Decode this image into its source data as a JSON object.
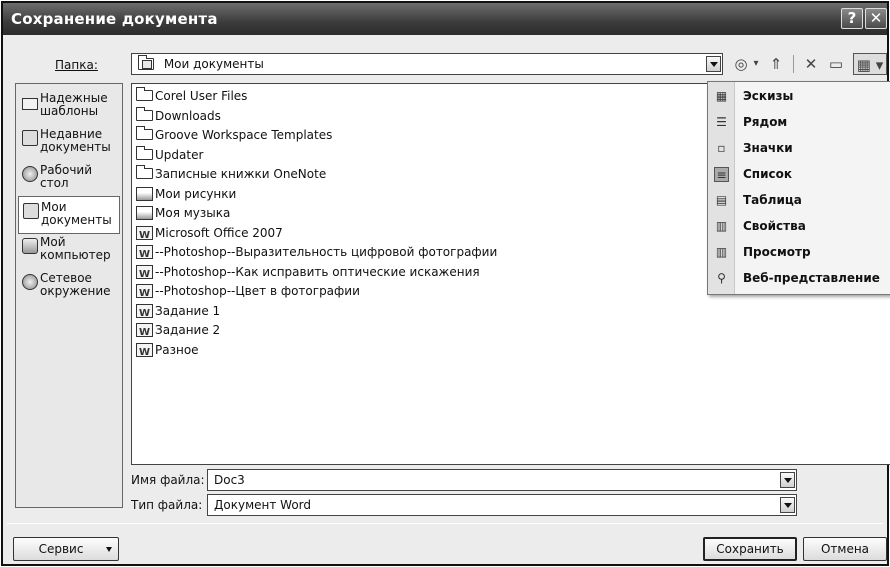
{
  "window": {
    "title": "Сохранение документа",
    "help_label": "?",
    "close_label": "✕"
  },
  "location": {
    "label": "Папка:",
    "value": "Мои документы"
  },
  "toolbar": {
    "back_icon": "◎",
    "back_dd": "▾",
    "up_icon": "⇑",
    "delete_icon": "✕",
    "newfolder_icon": "▭",
    "views_icon": "▦ ▾"
  },
  "places": [
    {
      "label": "Надежные\nшаблоны",
      "icon": "folder-icon"
    },
    {
      "label": "Недавние\nдокументы",
      "icon": "recent-documents-icon"
    },
    {
      "label": "Рабочий\nстол",
      "icon": "desktop-icon"
    },
    {
      "label": "Мои\nдокументы",
      "icon": "my-documents-icon",
      "selected": true
    },
    {
      "label": "Мой\nкомпьютер",
      "icon": "my-computer-icon"
    },
    {
      "label": "Сетевое\nокружение",
      "icon": "network-icon"
    }
  ],
  "files": [
    {
      "name": "Corel User Files",
      "type": "folder"
    },
    {
      "name": "Downloads",
      "type": "folder"
    },
    {
      "name": "Groove Workspace Templates",
      "type": "folder"
    },
    {
      "name": "Updater",
      "type": "folder"
    },
    {
      "name": "Записные книжки OneNote",
      "type": "folder"
    },
    {
      "name": "Мои рисунки",
      "type": "pictures"
    },
    {
      "name": "Моя музыка",
      "type": "music"
    },
    {
      "name": "Microsoft Office 2007",
      "type": "doc"
    },
    {
      "name": "--Photoshop--Выразительность цифровой фотографии",
      "type": "doc"
    },
    {
      "name": "--Photoshop--Как исправить оптические искажения",
      "type": "doc"
    },
    {
      "name": "--Photoshop--Цвет в фотографии",
      "type": "doc"
    },
    {
      "name": "Задание 1",
      "type": "doc"
    },
    {
      "name": "Задание 2",
      "type": "doc"
    },
    {
      "name": "Разное",
      "type": "doc"
    }
  ],
  "views_menu": [
    {
      "label": "Эскизы",
      "icon": "thumbnails-icon",
      "glyph": "▦"
    },
    {
      "label": "Рядом",
      "icon": "tiles-icon",
      "glyph": "☰"
    },
    {
      "label": "Значки",
      "icon": "icons-view-icon",
      "glyph": "▫"
    },
    {
      "label": "Список",
      "icon": "list-view-icon",
      "glyph": "≡",
      "selected": true
    },
    {
      "label": "Таблица",
      "icon": "details-view-icon",
      "glyph": "▤"
    },
    {
      "label": "Свойства",
      "icon": "properties-view-icon",
      "glyph": "▥"
    },
    {
      "label": "Просмотр",
      "icon": "preview-view-icon",
      "glyph": "▥"
    },
    {
      "label": "Веб-представление",
      "icon": "web-view-icon",
      "glyph": "⚲"
    }
  ],
  "filename": {
    "label": "Имя файла:",
    "value": "Doc3"
  },
  "filetype": {
    "label": "Тип файла:",
    "value": "Документ Word"
  },
  "buttons": {
    "tools": "Сервис",
    "save": "Сохранить",
    "cancel": "Отмена"
  }
}
